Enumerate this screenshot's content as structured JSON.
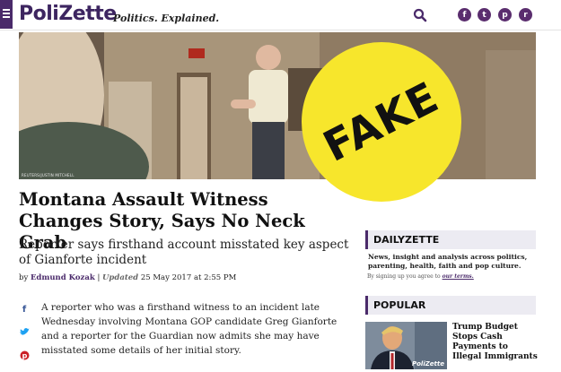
{
  "header": {
    "logo": "PoliZette",
    "tagline": "Politics. Explained.",
    "social_icons": [
      "facebook-icon",
      "twitter-icon",
      "pinterest-icon",
      "rss-icon"
    ],
    "social_glyphs": [
      "f",
      "t",
      "p",
      "r"
    ]
  },
  "hero": {
    "credit": "REUTERS/JUSTIN MITCHELL",
    "exit_sign": "EXIT",
    "stamp": "FAKE"
  },
  "article": {
    "headline": "Montana Assault Witness Changes Story, Says No Neck Grab",
    "subhead": "Reporter says firsthand account misstated key aspect of Gianforte incident",
    "byline_prefix": "by",
    "author": "Edmund Kozak",
    "separator": "|",
    "updated_label": "Updated",
    "date": "25 May 2017 at 2:55 PM",
    "body": "A reporter who was a firsthand witness to an incident late Wednesday involving Montana GOP candidate Greg Gianforte and a reporter for the Guardian now admits she may have misstated some details of her initial story."
  },
  "share_icons": [
    "facebook-share-icon",
    "twitter-share-icon",
    "pinterest-share-icon"
  ],
  "sidebar": {
    "dailyzette": {
      "title": "DAILYZETTE",
      "description": "News, insight and analysis across politics, parenting, health, faith and pop culture.",
      "note": "By signing up you agree to",
      "terms": "our terms."
    },
    "popular": {
      "title": "POPULAR",
      "item_title": "Trump Budget Stops Cash Payments to Illegal Immigrants",
      "thumb_logo": "PoliZette"
    }
  },
  "colors": {
    "brand": "#4a2a6a",
    "stamp": "#f7e62c",
    "sidebar_header_bg": "#ecebf2"
  }
}
